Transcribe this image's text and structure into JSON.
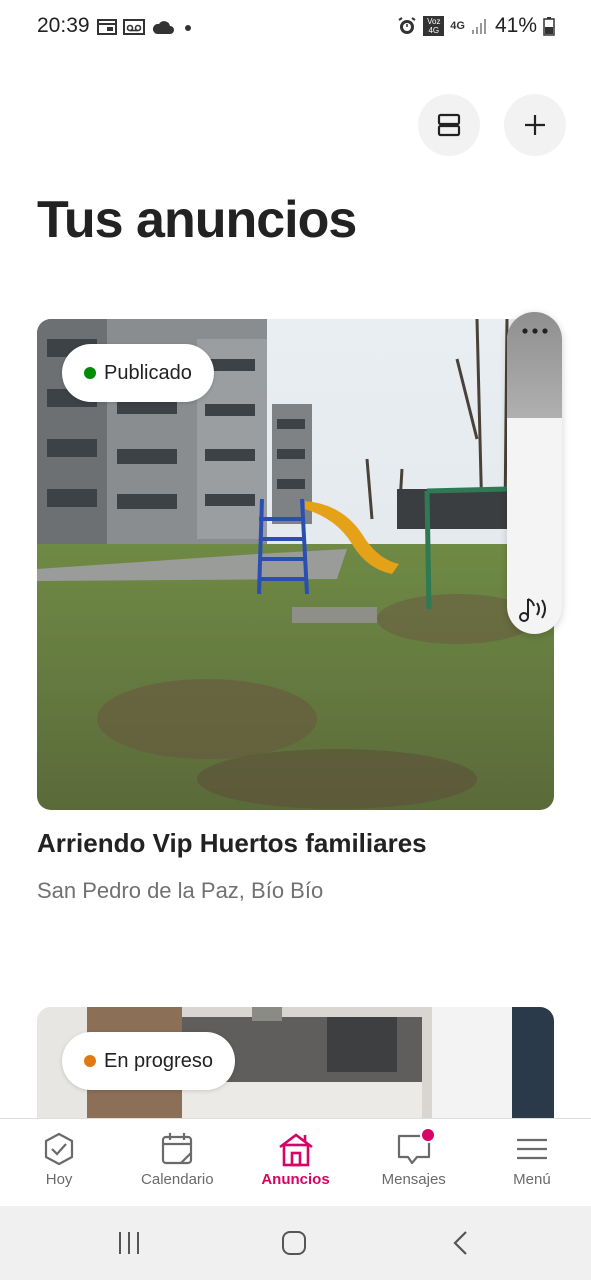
{
  "status_bar": {
    "time": "20:39",
    "left_icons": [
      "calendar-icon",
      "voicemail-icon",
      "cloud-icon",
      "dot-icon"
    ],
    "right_icons": [
      "alarm-icon",
      "volte-icon",
      "4g-icon",
      "signal-icon",
      "battery-icon"
    ],
    "network_label": "4G",
    "volte_label": "Voz 4G",
    "battery": "41%"
  },
  "header": {
    "title": "Tus anuncios",
    "view_toggle_icon": "list-view-icon",
    "add_icon": "plus-icon"
  },
  "listings": [
    {
      "status": "Publicado",
      "status_color": "#008a05",
      "title": "Arriendo Vip Huertos familiares",
      "location": "San Pedro de la Paz, Bío Bío",
      "photo": "playground-icon"
    },
    {
      "status": "En progreso",
      "status_color": "#e07912",
      "photo": "kitchen-icon"
    }
  ],
  "floating_panel": {
    "more_icon": "more-dots-icon",
    "audio_icon": "music-sound-icon"
  },
  "tab_bar": {
    "tabs": [
      {
        "label": "Hoy",
        "icon": "check-circle-icon",
        "active": false
      },
      {
        "label": "Calendario",
        "icon": "calendar-icon",
        "active": false
      },
      {
        "label": "Anuncios",
        "icon": "house-icon",
        "active": true
      },
      {
        "label": "Mensajes",
        "icon": "message-icon",
        "active": false,
        "badge": true
      },
      {
        "label": "Menú",
        "icon": "menu-icon",
        "active": false
      }
    ],
    "accent": "#d70466"
  },
  "system_nav": {
    "buttons": [
      "recents-icon",
      "home-icon",
      "back-icon"
    ]
  }
}
